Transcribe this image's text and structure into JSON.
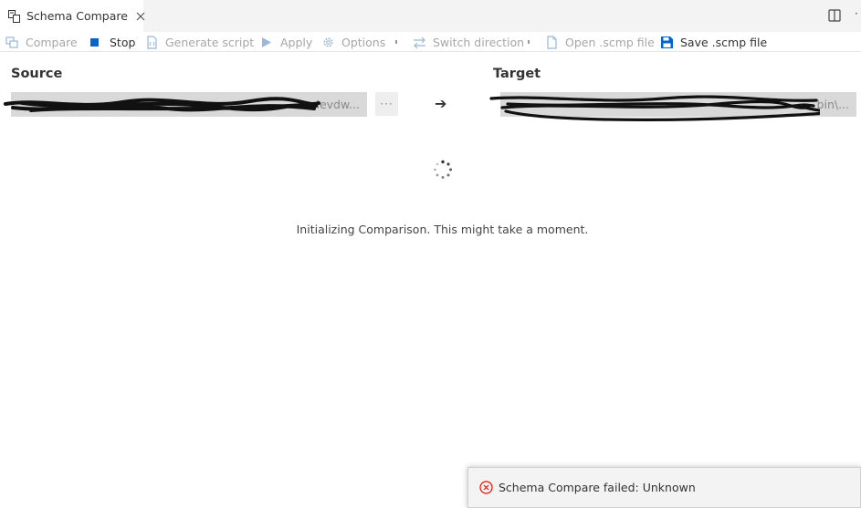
{
  "tab": {
    "title": "Schema Compare"
  },
  "toolbar": {
    "compare": "Compare",
    "stop": "Stop",
    "generate_script": "Generate script",
    "apply": "Apply",
    "options": "Options",
    "switch_direction": "Switch direction",
    "open_scmp": "Open .scmp file",
    "save_scmp": "Save .scmp file"
  },
  "source": {
    "label": "Source",
    "path_visible": "levdw..."
  },
  "target": {
    "label": "Target",
    "path_visible": "bin\\..."
  },
  "direction_arrow": "➔",
  "browse_button": "···",
  "status": {
    "message": "Initializing Comparison. This might take a moment."
  },
  "notification": {
    "message": "Schema Compare failed: Unknown"
  },
  "colors": {
    "accent": "#0066cc",
    "error": "#e51400",
    "disabled": "#a6a6a6"
  },
  "icons": [
    "schema-compare-icon",
    "close-icon",
    "split-editor-icon",
    "compare-icon",
    "stop-icon",
    "generate-script-icon",
    "apply-icon",
    "options-icon",
    "switch-direction-icon",
    "open-file-icon",
    "save-icon",
    "loading-spinner-icon",
    "error-icon"
  ]
}
